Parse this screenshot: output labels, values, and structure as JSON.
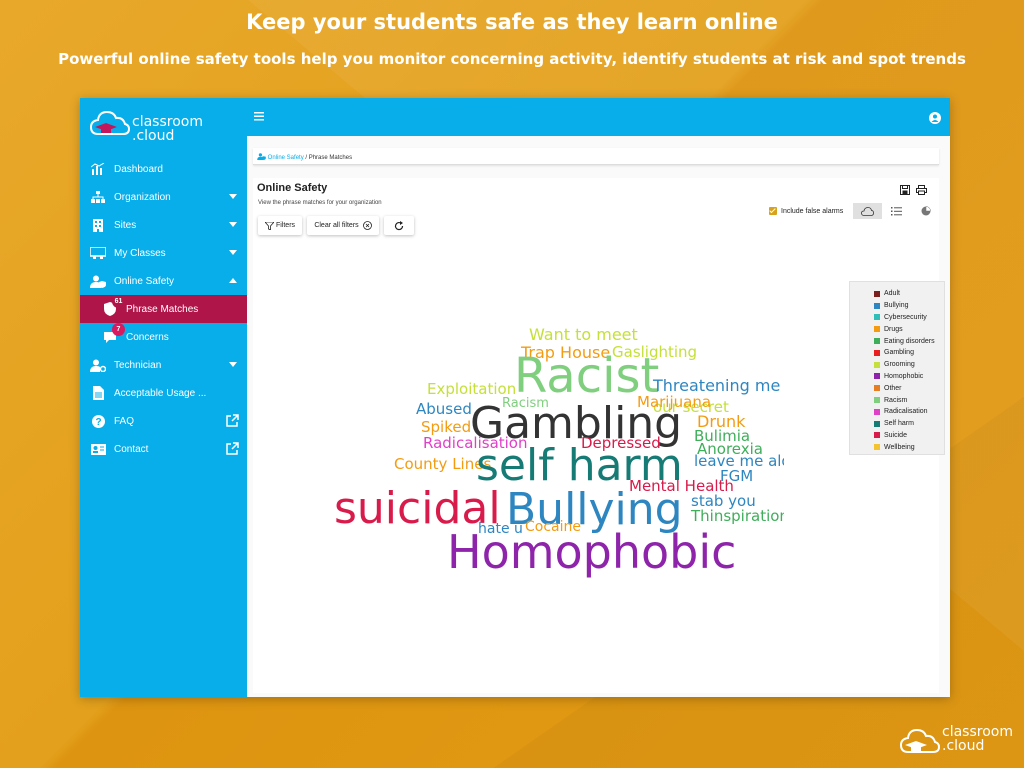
{
  "marketing": {
    "headline": "Keep your students safe as they learn online",
    "subheadline": "Powerful online safety tools help you monitor concerning activity, identify students at risk and spot trends",
    "logo_line1": "classroom",
    "logo_line2": ".cloud"
  },
  "sidebar": {
    "logo_line1": "classroom",
    "logo_line2": ".cloud",
    "items": [
      {
        "label": "Dashboard",
        "icon": "chart-icon"
      },
      {
        "label": "Organization",
        "icon": "org-chart-icon"
      },
      {
        "label": "Sites",
        "icon": "building-icon"
      },
      {
        "label": "My Classes",
        "icon": "classroom-icon"
      },
      {
        "label": "Online Safety",
        "icon": "user-shield-icon"
      },
      {
        "label": "Phrase Matches",
        "icon": "shield-icon",
        "badge": "61"
      },
      {
        "label": "Concerns",
        "icon": "comment-icon",
        "badge": "7"
      },
      {
        "label": "Technician",
        "icon": "user-gear-icon"
      },
      {
        "label": "Acceptable Usage ...",
        "icon": "document-icon"
      },
      {
        "label": "FAQ",
        "icon": "question-icon"
      },
      {
        "label": "Contact",
        "icon": "contact-card-icon"
      }
    ]
  },
  "topbar": {
    "menu_icon": "hamburger-icon",
    "user_icon": "user-circle-icon"
  },
  "breadcrumb": {
    "link": "Online Safety",
    "separator": "/",
    "current": "Phrase Matches"
  },
  "page": {
    "title": "Online Safety",
    "subtitle": "View the phrase matches for your organization",
    "filters_label": "Filters",
    "clear_filters_label": "Clear all filters",
    "false_alarms_label": "Include false alarms"
  },
  "colors": {
    "background": "#E09A12",
    "sidebar": "#07AEEA",
    "active_item": "#B0154A",
    "badge": "#D81B60"
  },
  "legend": [
    {
      "label": "Adult",
      "color": "#7B1E1E"
    },
    {
      "label": "Bullying",
      "color": "#2E86C1"
    },
    {
      "label": "Cybersecurity",
      "color": "#2DBFB8"
    },
    {
      "label": "Drugs",
      "color": "#F39C12"
    },
    {
      "label": "Eating disorders",
      "color": "#3FAE5A"
    },
    {
      "label": "Gambling",
      "color": "#E91E1E"
    },
    {
      "label": "Grooming",
      "color": "#C5E03A"
    },
    {
      "label": "Homophobic",
      "color": "#8E24AA"
    },
    {
      "label": "Other",
      "color": "#E67E22"
    },
    {
      "label": "Racism",
      "color": "#7FCF7F"
    },
    {
      "label": "Radicalisation",
      "color": "#E040C8"
    },
    {
      "label": "Self harm",
      "color": "#167A75"
    },
    {
      "label": "Suicide",
      "color": "#D81B4A"
    },
    {
      "label": "Wellbeing",
      "color": "#F4C430"
    }
  ],
  "word_cloud": [
    {
      "text": "Want to meet",
      "color": "#C5E03A",
      "size": 16
    },
    {
      "text": "Trap House",
      "color": "#F39C12",
      "size": 16
    },
    {
      "text": "Gaslighting",
      "color": "#C5E03A",
      "size": 15
    },
    {
      "text": "Racist",
      "color": "#7FCF7F",
      "size": 48
    },
    {
      "text": "Threatening me",
      "color": "#2E86C1",
      "size": 16
    },
    {
      "text": "Exploitation",
      "color": "#C5E03A",
      "size": 15
    },
    {
      "text": "Racism",
      "color": "#7FCF7F",
      "size": 13
    },
    {
      "text": "our secret",
      "color": "#C5E03A",
      "size": 15
    },
    {
      "text": "Marijuana",
      "color": "#F39C12",
      "size": 15
    },
    {
      "text": "Abused",
      "color": "#2E86C1",
      "size": 15
    },
    {
      "text": "Gambling",
      "color": "#333333",
      "size": 44
    },
    {
      "text": "Drunk",
      "color": "#F39C12",
      "size": 16
    },
    {
      "text": "Spiked",
      "color": "#F39C12",
      "size": 15
    },
    {
      "text": "Bulimia",
      "color": "#3FAE5A",
      "size": 15
    },
    {
      "text": "Radicalisation",
      "color": "#E040C8",
      "size": 15
    },
    {
      "text": "Depressed",
      "color": "#D81B4A",
      "size": 15
    },
    {
      "text": "Anorexia",
      "color": "#3FAE5A",
      "size": 15
    },
    {
      "text": "County Lines",
      "color": "#F39C12",
      "size": 15
    },
    {
      "text": "self harm",
      "color": "#167A75",
      "size": 44
    },
    {
      "text": "leave me alone",
      "color": "#2E86C1",
      "size": 15
    },
    {
      "text": "FGM",
      "color": "#2E86C1",
      "size": 15
    },
    {
      "text": "Mental Health",
      "color": "#D81B4A",
      "size": 15
    },
    {
      "text": "suicidal",
      "color": "#D81B4A",
      "size": 44
    },
    {
      "text": "Bullying",
      "color": "#2E86C1",
      "size": 44
    },
    {
      "text": "stab you",
      "color": "#2E86C1",
      "size": 15
    },
    {
      "text": "Thinspiration",
      "color": "#3FAE5A",
      "size": 15
    },
    {
      "text": "hate u",
      "color": "#2E86C1",
      "size": 14
    },
    {
      "text": "Cocaine",
      "color": "#F39C12",
      "size": 14
    },
    {
      "text": "Homophobic",
      "color": "#8E24AA",
      "size": 46
    }
  ]
}
